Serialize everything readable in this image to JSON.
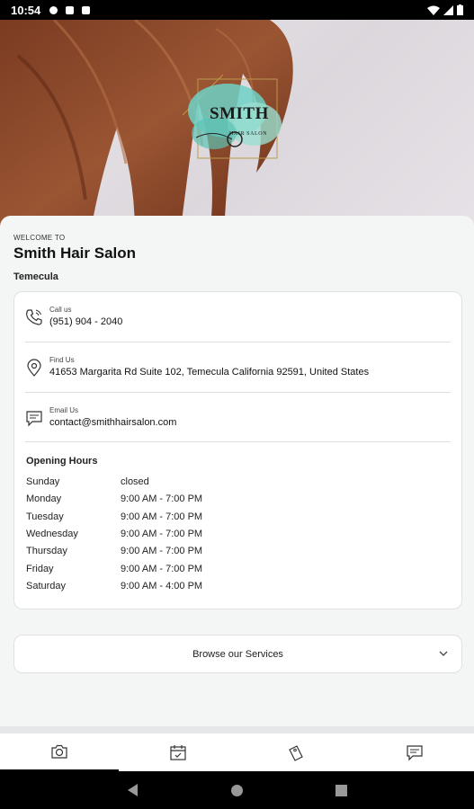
{
  "status_bar": {
    "time": "10:54"
  },
  "hero": {
    "logo_title": "SMITH",
    "logo_subtitle": "HAIR SALON"
  },
  "salon": {
    "welcome": "WELCOME TO",
    "name": "Smith Hair Salon",
    "city": "Temecula"
  },
  "contact": [
    {
      "label": "Call us",
      "value": "(951) 904 - 2040",
      "icon": "phone-icon"
    },
    {
      "label": "Find Us",
      "value": "41653 Margarita Rd Suite 102, Temecula California 92591, United States",
      "icon": "location-pin-icon"
    },
    {
      "label": "Email Us",
      "value": "contact@smithhairsalon.com",
      "icon": "message-icon"
    }
  ],
  "hours": {
    "title": "Opening Hours",
    "rows": [
      {
        "day": "Sunday",
        "hours": "closed"
      },
      {
        "day": "Monday",
        "hours": "9:00 AM - 7:00 PM"
      },
      {
        "day": "Tuesday",
        "hours": "9:00 AM - 7:00 PM"
      },
      {
        "day": "Wednesday",
        "hours": "9:00 AM - 7:00 PM"
      },
      {
        "day": "Thursday",
        "hours": "9:00 AM - 7:00 PM"
      },
      {
        "day": "Friday",
        "hours": "9:00 AM - 7:00 PM"
      },
      {
        "day": "Saturday",
        "hours": "9:00 AM - 4:00 PM"
      }
    ]
  },
  "services": {
    "label": "Browse our Services"
  },
  "tabs": [
    {
      "icon": "camera-icon"
    },
    {
      "icon": "calendar-icon"
    },
    {
      "icon": "tag-icon"
    },
    {
      "icon": "chat-icon"
    }
  ],
  "colors": {
    "sheet": "#f4f5f5",
    "card": "#ffffff",
    "logo_accent": "#6fd1c7"
  }
}
